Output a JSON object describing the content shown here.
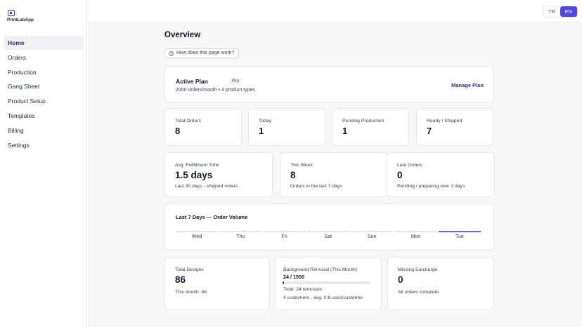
{
  "app": {
    "logo_text": "PrintLabApp"
  },
  "sidebar": {
    "items": [
      {
        "label": "Home",
        "active": true
      },
      {
        "label": "Orders"
      },
      {
        "label": "Production"
      },
      {
        "label": "Gang Sheet"
      },
      {
        "label": "Product Setup"
      },
      {
        "label": "Templates"
      },
      {
        "label": "Billing"
      },
      {
        "label": "Settings"
      }
    ]
  },
  "header": {
    "lang_tr": "TR",
    "lang_en": "EN",
    "active_lang": "EN"
  },
  "page": {
    "title": "Overview",
    "help_label": "How does this page work?"
  },
  "plan": {
    "name": "Active Plan",
    "badge": "Pro",
    "description": "2000 orders/month • 4 product types",
    "manage_label": "Manage Plan"
  },
  "stats": [
    {
      "label": "Total Orders",
      "value": "8"
    },
    {
      "label": "Today",
      "value": "1"
    },
    {
      "label": "Pending Production",
      "value": "1"
    },
    {
      "label": "Ready / Shipped",
      "value": "7"
    }
  ],
  "metrics": [
    {
      "label": "Avg. Fulfillment Time",
      "value": "1.5 days",
      "sub": "Last 30 days - shipped orders"
    },
    {
      "label": "This Week",
      "value": "8",
      "sub": "Orders in the last 7 days"
    },
    {
      "label": "Late Orders",
      "value": "0",
      "sub": "Pending / preparing over 2 days"
    }
  ],
  "weekly": {
    "title": "Last 7 Days — Order Volume",
    "days": [
      "Wed",
      "Thu",
      "Fri",
      "Sat",
      "Sun",
      "Mon",
      "Tue"
    ],
    "active_day": "Tue"
  },
  "designs": {
    "label": "Total Designs",
    "value": "86",
    "sub": "This month: 86"
  },
  "removal": {
    "label": "Background Removal (This Month)",
    "usage": "24 / 1500",
    "used": 24,
    "limit": 1500,
    "total": "Total: 24 removals",
    "customers": "4 customers · avg. 0.8 uses/customer"
  },
  "surcharge": {
    "label": "Missing Surcharge",
    "value": "0",
    "sub": "All orders complete"
  },
  "colors": {
    "accent": "#4f46e5",
    "nav_active_text": "#312e81"
  }
}
